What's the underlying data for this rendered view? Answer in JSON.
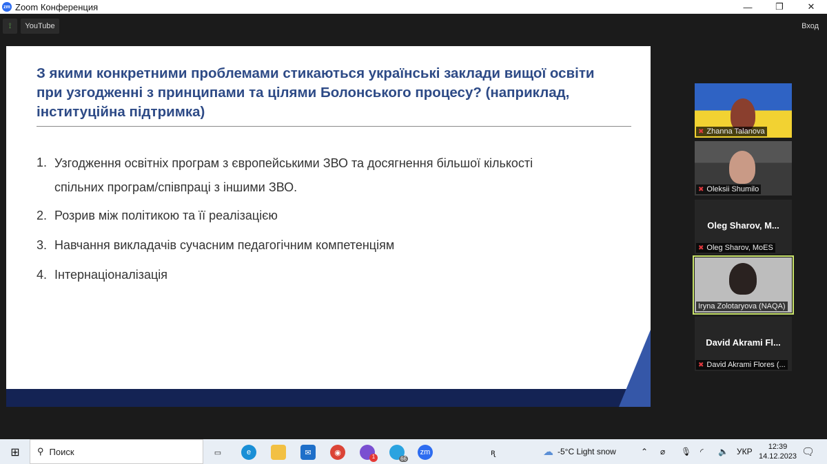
{
  "window": {
    "title": "Zoom Конференция",
    "logo": "zm",
    "controls": [
      "—",
      "❐",
      "✕"
    ]
  },
  "toolbar": {
    "youtube_label": "YouTube",
    "login_label": "Вход"
  },
  "slide": {
    "title": "З якими конкретними проблемами стикаються українські заклади вищої освіти при узгодженні з принципами та цілями Болонського процесу? (наприклад, інституційна підтримка)",
    "items": [
      {
        "num": "1.",
        "text": "Узгодження освітніх програм з європейськими ЗВО та досягнення більшої кількості спільних програм/співпраці з іншими ЗВО."
      },
      {
        "num": "2.",
        "text": "Розрив між політикою та її реалізацією"
      },
      {
        "num": "3.",
        "text": "Навчання викладачів сучасним педагогічним компетенціям"
      },
      {
        "num": "4.",
        "text": "Інтернаціоналізація"
      }
    ]
  },
  "participants": [
    {
      "name": "Zhanna Talanova"
    },
    {
      "name": "Oleksii Shumilo"
    },
    {
      "name": "Oleg Sharov, MoES",
      "display": "Oleg Sharov, M..."
    },
    {
      "name": "Iryna Zolotaryova (NAQA)"
    },
    {
      "name": "David Akrami Flores (...",
      "display": "David Akrami Fl..."
    }
  ],
  "taskbar": {
    "search_label": "Поиск",
    "viber_badge": "1",
    "telegram_badge": "66",
    "zoom_label": "zm",
    "weather": "-5°C  Light snow",
    "language": "УКР",
    "time": "12:39",
    "date": "14.12.2023"
  }
}
